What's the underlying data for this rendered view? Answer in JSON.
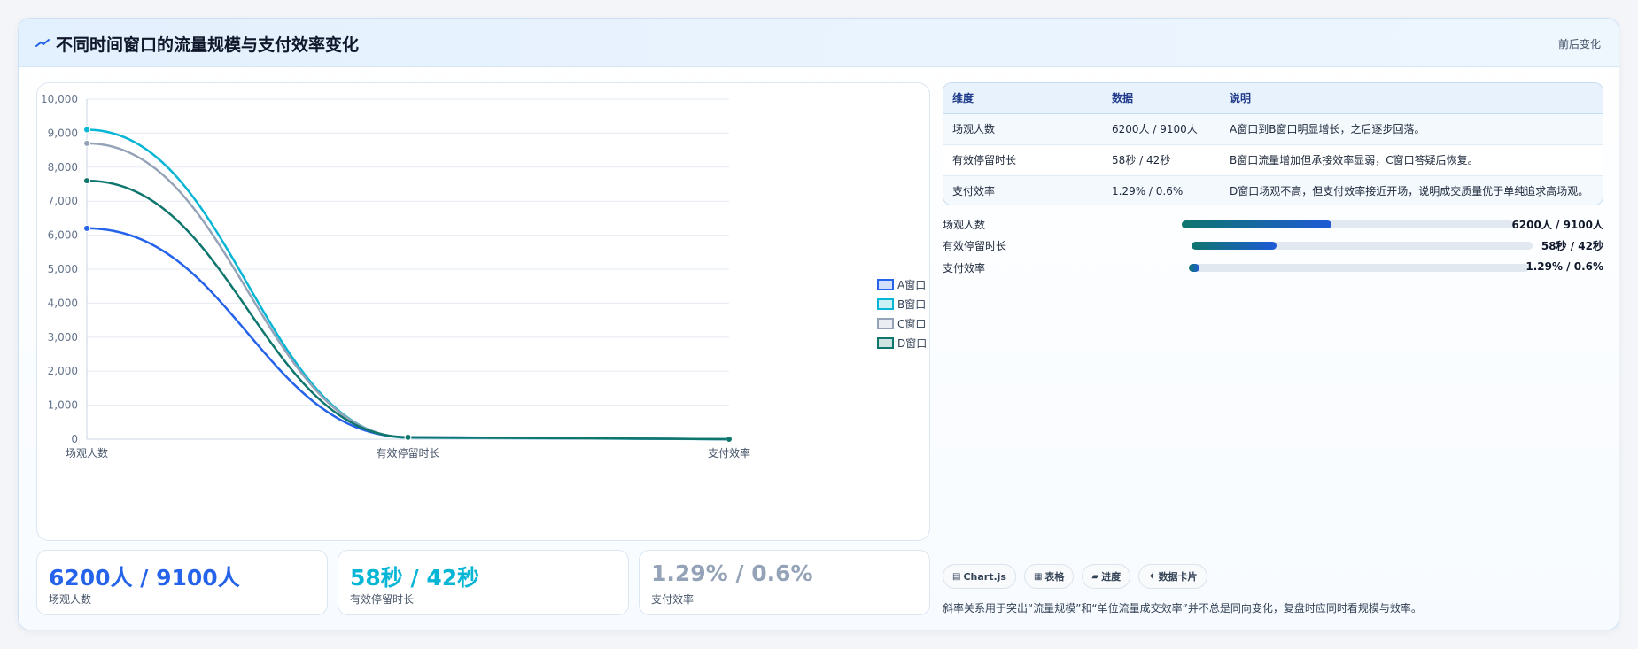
{
  "header": {
    "title": "不同时间窗口的流量规模与支付效率变化",
    "right_label": "前后变化",
    "icon": "trend-icon"
  },
  "chart_data": {
    "type": "line",
    "categories": [
      "场观人数",
      "有效停留时长",
      "支付效率"
    ],
    "ylim": [
      0,
      10000
    ],
    "yticks": [
      0,
      1000,
      2000,
      3000,
      4000,
      5000,
      6000,
      7000,
      8000,
      9000,
      10000
    ],
    "ytick_labels": [
      "0",
      "1,000",
      "2,000",
      "3,000",
      "4,000",
      "5,000",
      "6,000",
      "7,000",
      "8,000",
      "9,000",
      "10,000"
    ],
    "legend_position": "right",
    "grid": true,
    "series": [
      {
        "name": "A窗口",
        "color": "#2563eb",
        "values": [
          6200,
          58,
          1.29
        ]
      },
      {
        "name": "B窗口",
        "color": "#06b6d4",
        "values": [
          9100,
          42,
          0.6
        ]
      },
      {
        "name": "C窗口",
        "color": "#94a3b8",
        "values": [
          8700,
          50,
          0.9
        ]
      },
      {
        "name": "D窗口",
        "color": "#0f766e",
        "values": [
          7600,
          55,
          1.1
        ]
      }
    ]
  },
  "kpis": [
    {
      "value": "6200人 / 9100人",
      "label": "场观人数",
      "color": "#2563eb"
    },
    {
      "value": "58秒 / 42秒",
      "label": "有效停留时长",
      "color": "#06b6d4"
    },
    {
      "value": "1.29% / 0.6%",
      "label": "支付效率",
      "color": "#94a3b8"
    }
  ],
  "table": {
    "headers": [
      "维度",
      "数据",
      "说明"
    ],
    "rows": [
      [
        "场观人数",
        "6200人 / 9100人",
        "A窗口到B窗口明显增长，之后逐步回落。"
      ],
      [
        "有效停留时长",
        "58秒 / 42秒",
        "B窗口流量增加但承接效率显弱，C窗口答疑后恢复。"
      ],
      [
        "支付效率",
        "1.29% / 0.6%",
        "D窗口场观不高，但支付效率接近开场，说明成交质量优于单纯追求高场观。"
      ]
    ]
  },
  "progress": [
    {
      "label": "场观人数",
      "value": "6200人 / 9100人",
      "fraction": 0.45
    },
    {
      "label": "有效停留时长",
      "value": "58秒 / 42秒",
      "fraction": 0.25
    },
    {
      "label": "支付效率",
      "value": "1.29% / 0.6%",
      "fraction": 0.03
    }
  ],
  "chips": [
    {
      "icon": "▤",
      "label": "Chart.js"
    },
    {
      "icon": "▦",
      "label": "表格"
    },
    {
      "icon": "▰",
      "label": "进度"
    },
    {
      "icon": "✦",
      "label": "数据卡片"
    }
  ],
  "note": "斜率关系用于突出“流量规模”和“单位流量成交效率”并不总是同向变化，复盘时应同时看规模与效率。"
}
